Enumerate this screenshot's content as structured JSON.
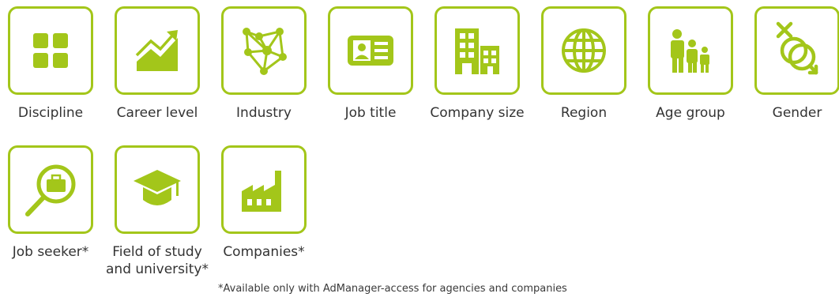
{
  "colors": {
    "accent": "#a3c61a",
    "text": "#333333"
  },
  "tiles": [
    {
      "label": "Discipline",
      "icon": "grid-icon"
    },
    {
      "label": "Career level",
      "icon": "trend-chart-icon"
    },
    {
      "label": "Industry",
      "icon": "network-icon"
    },
    {
      "label": "Job title",
      "icon": "id-card-icon"
    },
    {
      "label": "Company size",
      "icon": "buildings-icon"
    },
    {
      "label": "Region",
      "icon": "globe-icon"
    },
    {
      "label": "Age group",
      "icon": "people-icon"
    },
    {
      "label": "Gender",
      "icon": "gender-icon"
    },
    {
      "label": "Job seeker*",
      "icon": "magnifier-briefcase-icon"
    },
    {
      "label": "Field of study and university*",
      "icon": "graduation-cap-icon"
    },
    {
      "label": "Companies*",
      "icon": "factory-icon"
    }
  ],
  "footnote": "*Available only with AdManager-access for agencies and companies"
}
